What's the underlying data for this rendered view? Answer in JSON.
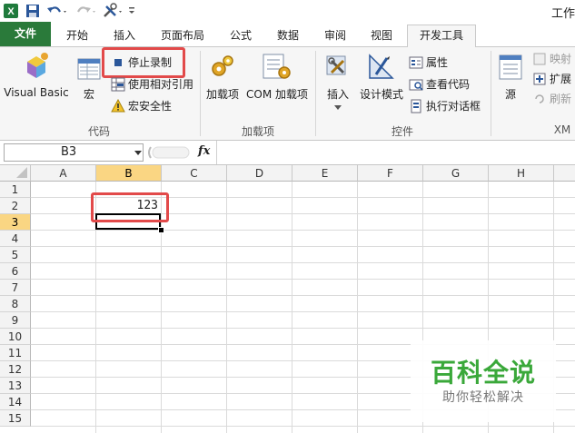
{
  "window": {
    "title": "工作"
  },
  "tabs": [
    {
      "label": "文件"
    },
    {
      "label": "开始"
    },
    {
      "label": "插入"
    },
    {
      "label": "页面布局"
    },
    {
      "label": "公式"
    },
    {
      "label": "数据"
    },
    {
      "label": "审阅"
    },
    {
      "label": "视图"
    },
    {
      "label": "开发工具"
    }
  ],
  "ribbon": {
    "code": {
      "group_label": "代码",
      "visual_basic": "Visual Basic",
      "macro": "宏",
      "stop_recording": "停止录制",
      "relative_ref": "使用相对引用",
      "macro_security": "宏安全性"
    },
    "addins": {
      "group_label": "加载项",
      "addins": "加载项",
      "com_addins": "COM 加载项"
    },
    "controls": {
      "group_label": "控件",
      "insert": "插入",
      "design_mode": "设计模式",
      "properties": "属性",
      "view_code": "查看代码",
      "run_dialog": "执行对话框"
    },
    "xml": {
      "group_label": "XM",
      "source": "源",
      "map_properties": "映射",
      "expansion_packs": "扩展",
      "refresh_data": "刷新"
    }
  },
  "formula_bar": {
    "name_box": "B3",
    "fx": "fx",
    "value": ""
  },
  "grid": {
    "columns": [
      "A",
      "B",
      "C",
      "D",
      "E",
      "F",
      "G",
      "H"
    ],
    "rows": [
      "1",
      "2",
      "3",
      "4",
      "5",
      "6",
      "7",
      "8",
      "9",
      "10",
      "11",
      "12",
      "13",
      "14",
      "15"
    ],
    "cells": {
      "B2": "123"
    },
    "selected_cell": "B3"
  },
  "watermark": {
    "title": "百科全说",
    "subtitle": "助你轻松解决"
  },
  "colors": {
    "file_tab": "#2a7a3a",
    "highlight": "#e24a4a",
    "selected_header": "#fad683"
  }
}
